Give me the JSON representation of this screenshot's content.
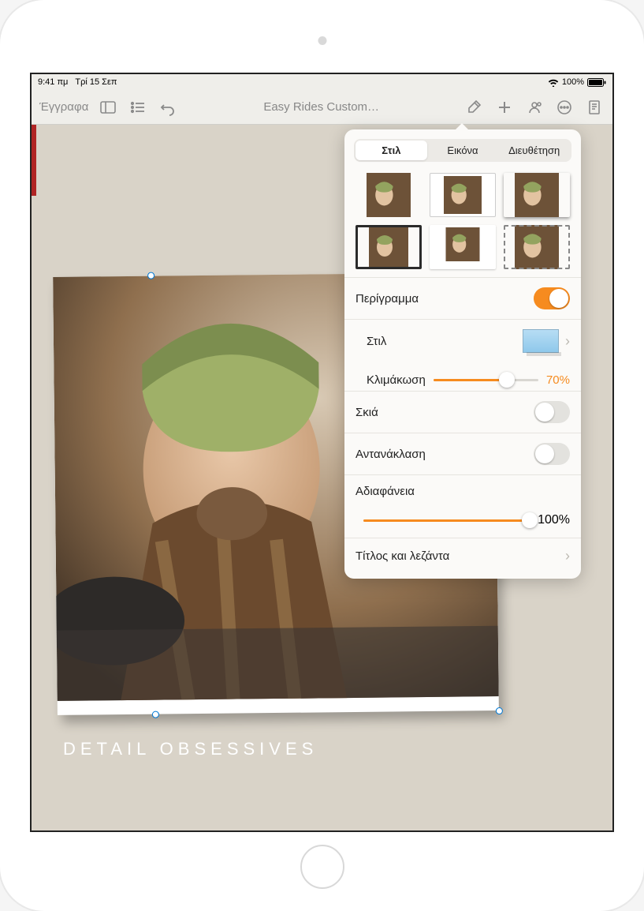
{
  "status": {
    "time": "9:41 πμ",
    "date": "Τρί 15 Σεπ",
    "battery": "100%"
  },
  "toolbar": {
    "documents": "Έγγραφα",
    "title": "Easy Rides Custom…"
  },
  "canvas": {
    "caption": "DETAIL OBSESSIVES"
  },
  "popover": {
    "tabs": {
      "style": "Στιλ",
      "image": "Εικόνα",
      "arrange": "Διευθέτηση"
    },
    "outline": {
      "label": "Περίγραμμα",
      "on": true
    },
    "style_row": {
      "label": "Στιλ"
    },
    "scale": {
      "label": "Κλιμάκωση",
      "value": "70%",
      "percent": 70
    },
    "shadow": {
      "label": "Σκιά",
      "on": false
    },
    "reflection": {
      "label": "Αντανάκλαση",
      "on": false
    },
    "opacity": {
      "label": "Αδιαφάνεια",
      "value": "100%",
      "percent": 100
    },
    "title_caption": {
      "label": "Τίτλος και λεζάντα"
    }
  }
}
